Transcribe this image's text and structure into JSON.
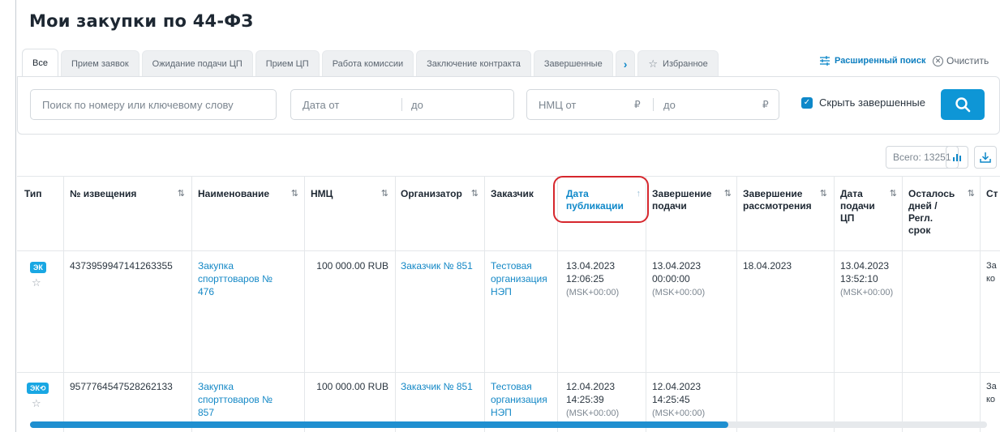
{
  "title": "Мои закупки по 44-ФЗ",
  "tabs": [
    {
      "label": "Все",
      "active": true
    },
    {
      "label": "Прием заявок"
    },
    {
      "label": "Ожидание подачи ЦП"
    },
    {
      "label": "Прием ЦП"
    },
    {
      "label": "Работа комиссии"
    },
    {
      "label": "Заключение контракта"
    },
    {
      "label": "Завершенные"
    }
  ],
  "tab_next_glyph": "›",
  "tab_favorites": "Избранное",
  "advanced_search": "Расширенный поиск",
  "clear": "Очистить",
  "filters": {
    "search_placeholder": "Поиск по номеру или ключевому слову",
    "date_from": "Дата от",
    "date_to": "до",
    "nmc_from": "НМЦ от",
    "nmc_to": "до",
    "currency": "₽",
    "hide_completed": "Скрыть завершенные",
    "hide_completed_checked": true
  },
  "total": "Всего: 13251",
  "columns": {
    "type": "Тип",
    "number": "№ извещения",
    "name": "Наименование",
    "nmc": "НМЦ",
    "organizer": "Организатор",
    "customer": "Заказчик",
    "pub_date_1": "Дата",
    "pub_date_2": "публикации",
    "sub_end_1": "Завершение",
    "sub_end_2": "подачи",
    "rev_end_1": "Завершение",
    "rev_end_2": "рассмотрения",
    "cp_1": "Дата",
    "cp_2": "подачи",
    "cp_3": "ЦП",
    "days_1": "Осталось",
    "days_2": "дней /",
    "days_3": "Регл.",
    "days_4": "срок",
    "status_partial": "Ст"
  },
  "rows": [
    {
      "badge": "ЭК",
      "number": "4373959947141263355",
      "name_1": "Закупка",
      "name_2": "спорттоваров №",
      "name_3": "476",
      "nmc": "100 000.00 RUB",
      "organizer": "Заказчик № 851",
      "customer_1": "Тестовая",
      "customer_2": "организация",
      "customer_3": "НЭП",
      "pub_date": "13.04.2023",
      "pub_time": "12:06:25",
      "pub_tz": "(MSK+00:00)",
      "sub_date": "13.04.2023",
      "sub_time": "00:00:00",
      "sub_tz": "(MSK+00:00)",
      "rev_date": "18.04.2023",
      "cp_date": "13.04.2023",
      "cp_time": "13:52:10",
      "cp_tz": "(MSK+00:00)",
      "status_1": "За",
      "status_2": "ко"
    },
    {
      "badge": "ЭК⟲",
      "number": "9577764547528262133",
      "name_1": "Закупка",
      "name_2": "спорттоваров №",
      "name_3": "857",
      "nmc": "100 000.00 RUB",
      "organizer": "Заказчик № 851",
      "customer_1": "Тестовая",
      "customer_2": "организация",
      "customer_3": "НЭП",
      "pub_date": "12.04.2023",
      "pub_time": "14:25:39",
      "pub_tz": "(MSK+00:00)",
      "sub_date": "12.04.2023",
      "sub_time": "14:25:45",
      "sub_tz": "(MSK+00:00)",
      "status_1": "За",
      "status_2": "ко"
    }
  ],
  "sort_glyph": "⇅",
  "sort_up_glyph": "↑",
  "horizontal_scroll_fraction": 0.73,
  "colors": {
    "accent": "#0e88c9",
    "button": "#0e96d6",
    "highlight": "#d6272d",
    "badge": "#19a7e3"
  }
}
